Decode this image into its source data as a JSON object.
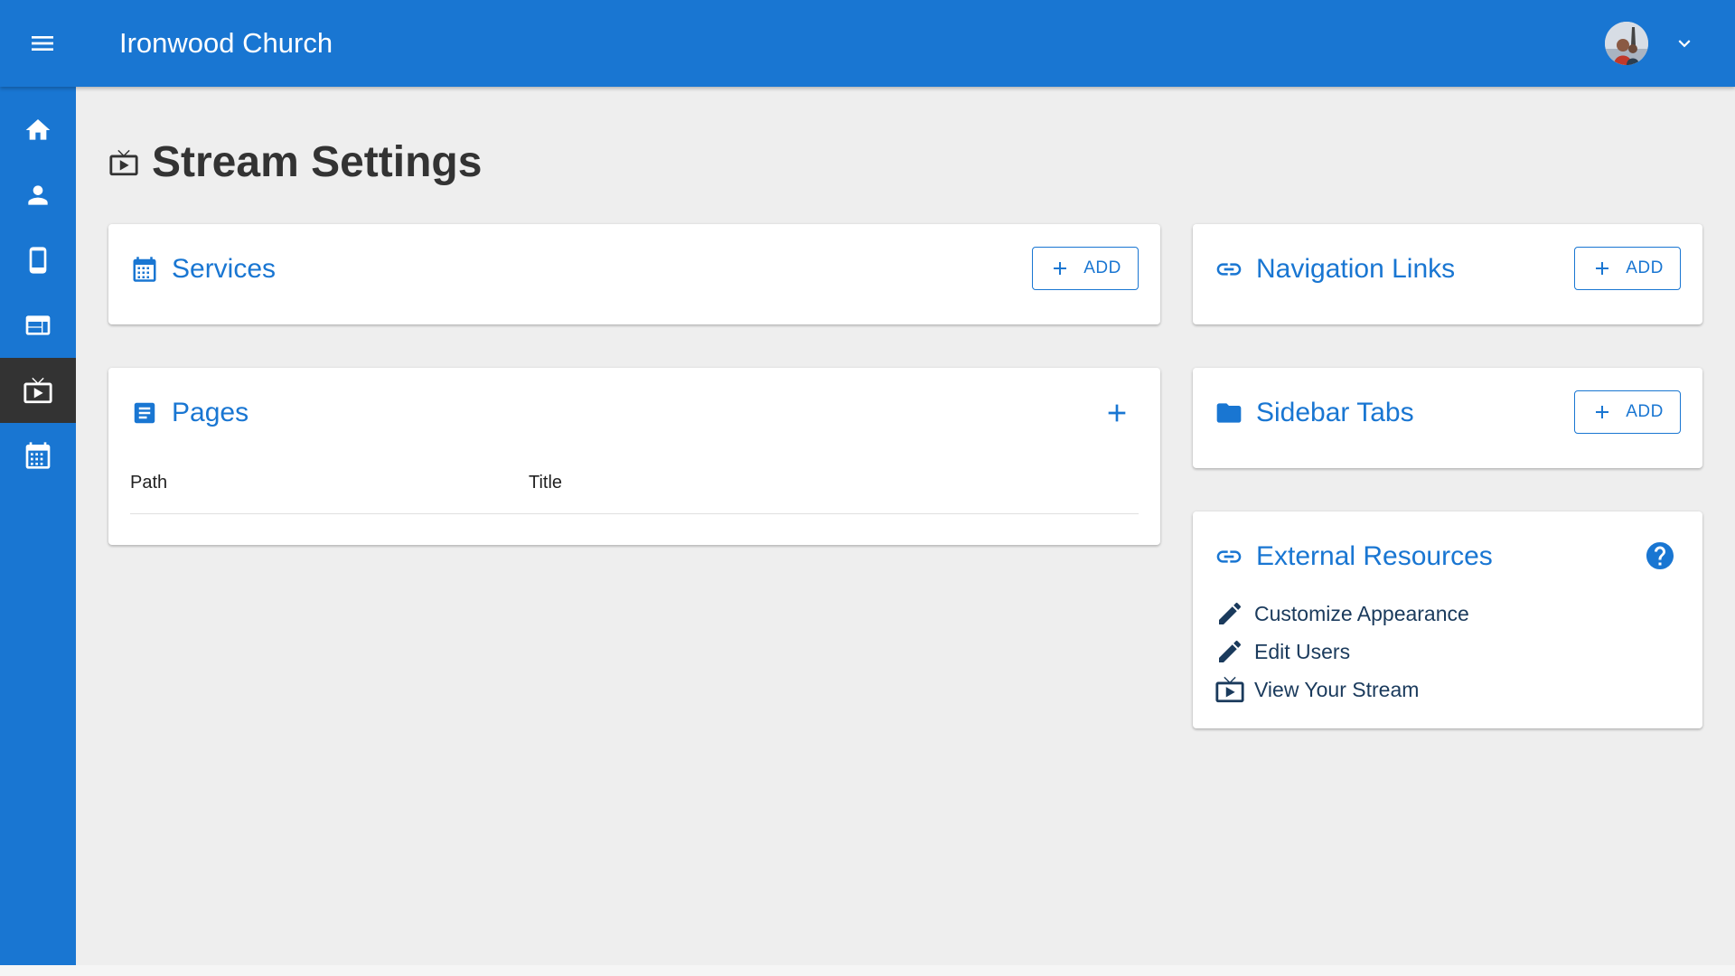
{
  "header": {
    "app_title": "Ironwood Church",
    "menu_icon": "menu-icon",
    "avatar_icon": "user-avatar",
    "dropdown_icon": "chevron-down-icon",
    "color": "#1976d2"
  },
  "sidebar": {
    "items": [
      {
        "icon": "home-icon"
      },
      {
        "icon": "person-icon"
      },
      {
        "icon": "smartphone-icon"
      },
      {
        "icon": "web-icon"
      },
      {
        "icon": "live-tv-icon",
        "active": true
      },
      {
        "icon": "calendar-icon"
      }
    ],
    "active_color": "#333333"
  },
  "page": {
    "title": "Stream Settings",
    "icon": "live-tv-icon"
  },
  "cards": {
    "services": {
      "title": "Services",
      "icon": "calendar-icon",
      "add_label": "ADD"
    },
    "pages": {
      "title": "Pages",
      "icon": "article-icon",
      "columns": [
        "Path",
        "Title"
      ],
      "rows": []
    },
    "navigation_links": {
      "title": "Navigation Links",
      "icon": "link-icon",
      "add_label": "ADD"
    },
    "sidebar_tabs": {
      "title": "Sidebar Tabs",
      "icon": "folder-icon",
      "add_label": "ADD"
    },
    "external_resources": {
      "title": "External Resources",
      "icon": "link-icon",
      "help_icon": "help-icon",
      "items": [
        {
          "label": "Customize Appearance",
          "icon": "edit-icon"
        },
        {
          "label": "Edit Users",
          "icon": "edit-icon"
        },
        {
          "label": "View Your Stream",
          "icon": "live-tv-icon"
        }
      ]
    }
  }
}
